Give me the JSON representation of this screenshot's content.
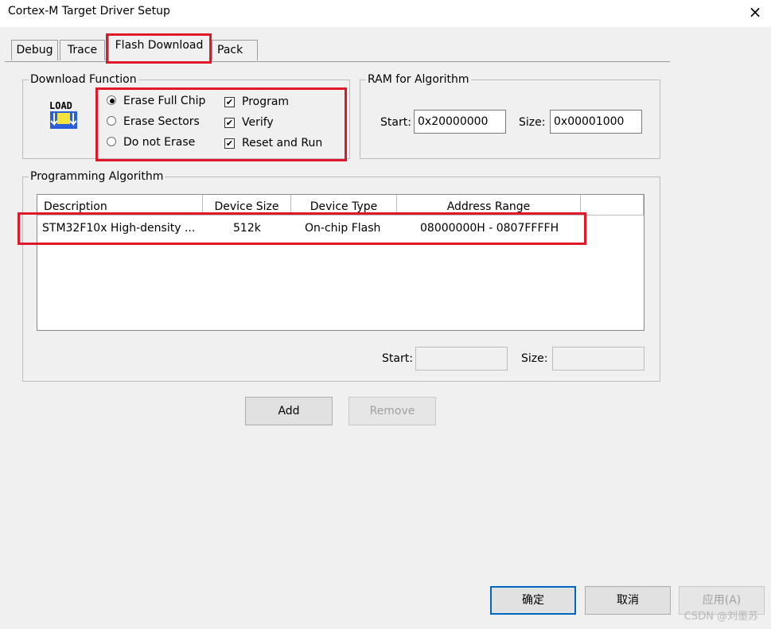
{
  "window": {
    "title": "Cortex-M Target Driver Setup",
    "close_icon": "×"
  },
  "tabs": [
    {
      "label": "Debug"
    },
    {
      "label": "Trace"
    },
    {
      "label": "Flash Download",
      "active": true
    },
    {
      "label": "Pack"
    }
  ],
  "download_function": {
    "legend": "Download Function",
    "icon": "LOAD",
    "radios": [
      {
        "label": "Erase Full Chip",
        "checked": true
      },
      {
        "label": "Erase Sectors",
        "checked": false
      },
      {
        "label": "Do not Erase",
        "checked": false
      }
    ],
    "checks": [
      {
        "label": "Program",
        "checked": true
      },
      {
        "label": "Verify",
        "checked": true
      },
      {
        "label": "Reset and Run",
        "checked": true
      }
    ]
  },
  "ram": {
    "legend": "RAM for Algorithm",
    "start_label": "Start:",
    "start_value": "0x20000000",
    "size_label": "Size:",
    "size_value": "0x00001000"
  },
  "algorithm": {
    "legend": "Programming Algorithm",
    "columns": [
      "Description",
      "Device Size",
      "Device Type",
      "Address Range"
    ],
    "rows": [
      {
        "description": "STM32F10x High-density ...",
        "size": "512k",
        "type": "On-chip Flash",
        "range": "08000000H - 0807FFFFH"
      }
    ],
    "start_label": "Start:",
    "size_label": "Size:",
    "start_value": "",
    "size_value": ""
  },
  "buttons": {
    "add": "Add",
    "remove": "Remove"
  },
  "footer": {
    "ok": "确定",
    "cancel": "取消",
    "apply": "应用(A)",
    "watermark": "CSDN @刘墨苏"
  },
  "colors": {
    "highlight": "#e0192a"
  }
}
